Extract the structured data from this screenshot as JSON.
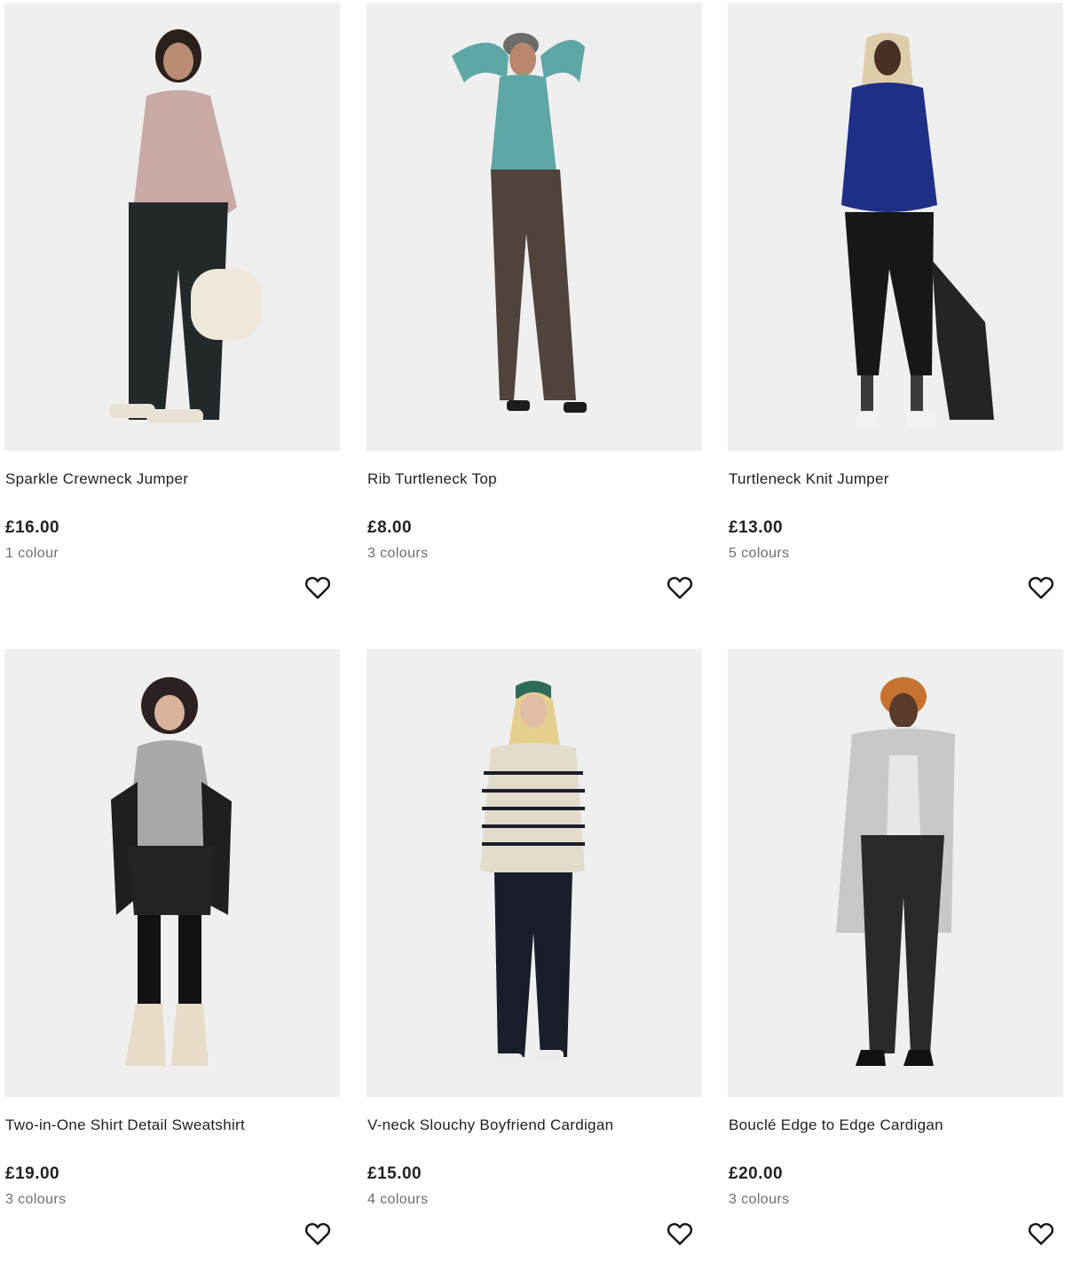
{
  "products": [
    {
      "name": "Sparkle Crewneck Jumper",
      "price": "£16.00",
      "colours": "1 colour",
      "image": "woman-pink-knit-jumper-black-jeans-teddy-bag",
      "top_color": "#c9aaa6",
      "bottom_color": "#23282b",
      "shoe_color": "#e8e2d6"
    },
    {
      "name": "Rib Turtleneck Top",
      "price": "£8.00",
      "colours": "3 colours",
      "image": "woman-teal-rib-top-brown-cargo-trousers",
      "top_color": "#5fa7a6",
      "bottom_color": "#4f433c",
      "shoe_color": "#1c1c1c"
    },
    {
      "name": "Turtleneck Knit Jumper",
      "price": "£13.00",
      "colours": "5 colours",
      "image": "woman-cobalt-blue-jumper-black-jeans",
      "top_color": "#1f2e86",
      "bottom_color": "#151718",
      "shoe_color": "#f2f2f2"
    },
    {
      "name": "Two-in-One Shirt Detail Sweatshirt",
      "price": "£19.00",
      "colours": "3 colours",
      "image": "woman-grey-sweatshirt-white-shirt-leather-jacket",
      "top_color": "#a9a9ab",
      "bottom_color": "#1b1b1c",
      "shoe_color": "#e6dcc8"
    },
    {
      "name": "V-neck Slouchy Boyfriend Cardigan",
      "price": "£15.00",
      "colours": "4 colours",
      "image": "woman-striped-cardigan-navy-trousers-green-cap",
      "top_color": "#e2dccd",
      "bottom_color": "#1a1d2a",
      "shoe_color": "#ececec"
    },
    {
      "name": "Bouclé Edge to Edge Cardigan",
      "price": "£20.00",
      "colours": "3 colours",
      "image": "woman-grey-boucle-cardigan-black-jeans",
      "top_color": "#c8c8c8",
      "bottom_color": "#2a2a2c",
      "shoe_color": "#111111"
    }
  ],
  "icons": {
    "wishlist": "heart-outline-icon"
  },
  "colors": {
    "card_bg": "#efefef",
    "text": "#1f1f1f",
    "muted": "#6e6e6e"
  }
}
